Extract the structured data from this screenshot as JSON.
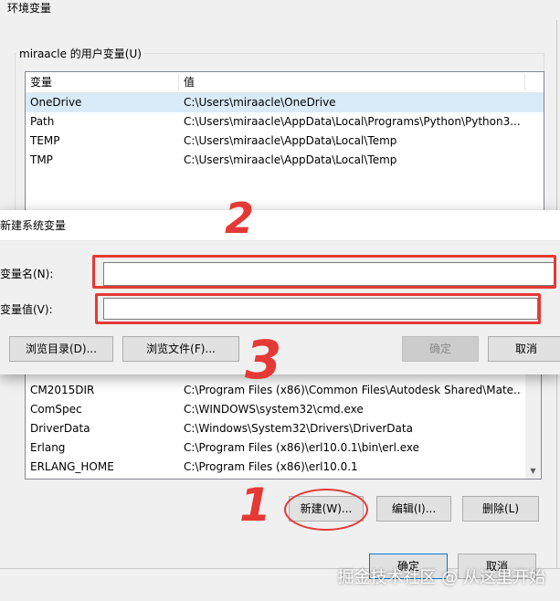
{
  "window": {
    "title": "环境变量"
  },
  "user_vars": {
    "group_label": "miraacle 的用户变量(U)",
    "columns": [
      "变量",
      "值"
    ],
    "rows": [
      {
        "name": "OneDrive",
        "value": "C:\\Users\\miraacle\\OneDrive",
        "selected": true
      },
      {
        "name": "Path",
        "value": "C:\\Users\\miraacle\\AppData\\Local\\Programs\\Python\\Python3..."
      },
      {
        "name": "TEMP",
        "value": "C:\\Users\\miraacle\\AppData\\Local\\Temp"
      },
      {
        "name": "TMP",
        "value": "C:\\Users\\miraacle\\AppData\\Local\\Temp"
      }
    ]
  },
  "system_vars": {
    "rows": [
      {
        "name": "CM2015DIR",
        "value": "C:\\Program Files (x86)\\Common Files\\Autodesk Shared\\Mate..."
      },
      {
        "name": "ComSpec",
        "value": "C:\\WINDOWS\\system32\\cmd.exe"
      },
      {
        "name": "DriverData",
        "value": "C:\\Windows\\System32\\Drivers\\DriverData"
      },
      {
        "name": "Erlang",
        "value": "C:\\Program Files (x86)\\erl10.0.1\\bin\\erl.exe"
      },
      {
        "name": "ERLANG_HOME",
        "value": "C:\\Program Files (x86)\\erl10.0.1"
      }
    ],
    "buttons": {
      "new": "新建(W)...",
      "edit": "编辑(I)...",
      "delete": "删除(L)"
    }
  },
  "footer_buttons": {
    "ok": "确定",
    "cancel": "取消"
  },
  "new_system_var_dialog": {
    "title": "新建系统变量",
    "name_label": "变量名(N):",
    "value_label": "变量值(V):",
    "name_value": "",
    "value_value": "",
    "browse_dir": "浏览目录(D)...",
    "browse_file": "浏览文件(F)...",
    "ok": "确定",
    "cancel": "取消"
  },
  "annotations": {
    "n1": "1",
    "n2": "2",
    "n3": "3",
    "color": "#e53935"
  },
  "watermark": "掘金技术社区 @ 从这里开始"
}
